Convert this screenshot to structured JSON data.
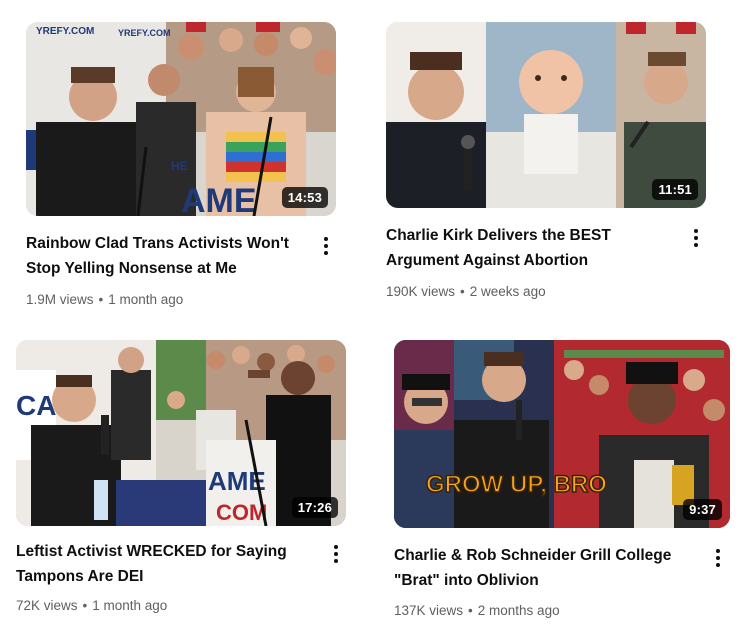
{
  "videos": [
    {
      "title_line1": "Rainbow Clad Trans Activists Won't",
      "title_line2": "Stop Yelling Nonsense at Me",
      "views": "1.9M views",
      "age": "1 month ago",
      "duration": "14:53",
      "thumb_text": [
        "YREFY.COM",
        "YREFY.COM",
        "AME",
        "HE"
      ]
    },
    {
      "title_line1": "Charlie Kirk Delivers the BEST",
      "title_line2": "Argument Against Abortion",
      "views": "190K views",
      "age": "2 weeks ago",
      "duration": "11:51",
      "thumb_text": []
    },
    {
      "title_line1": "Leftist Activist WRECKED for Saying",
      "title_line2": "Tampons Are DEI",
      "views": "72K views",
      "age": "1 month ago",
      "duration": "17:26",
      "thumb_text": [
        "CA",
        "AME",
        "COM"
      ]
    },
    {
      "title_line1": "Charlie & Rob Schneider Grill College",
      "title_line2": "\"Brat\" into Oblivion",
      "views": "137K views",
      "age": "2 months ago",
      "duration": "9:37",
      "thumb_text": [
        "GROW UP, BRO"
      ]
    }
  ],
  "separator": "•",
  "icons": {
    "more": "more-vert-icon"
  },
  "colors": {
    "title": "#0f0f0f",
    "meta": "#606060",
    "duration_bg": "#000000",
    "overlay_text": "#f5a623"
  }
}
